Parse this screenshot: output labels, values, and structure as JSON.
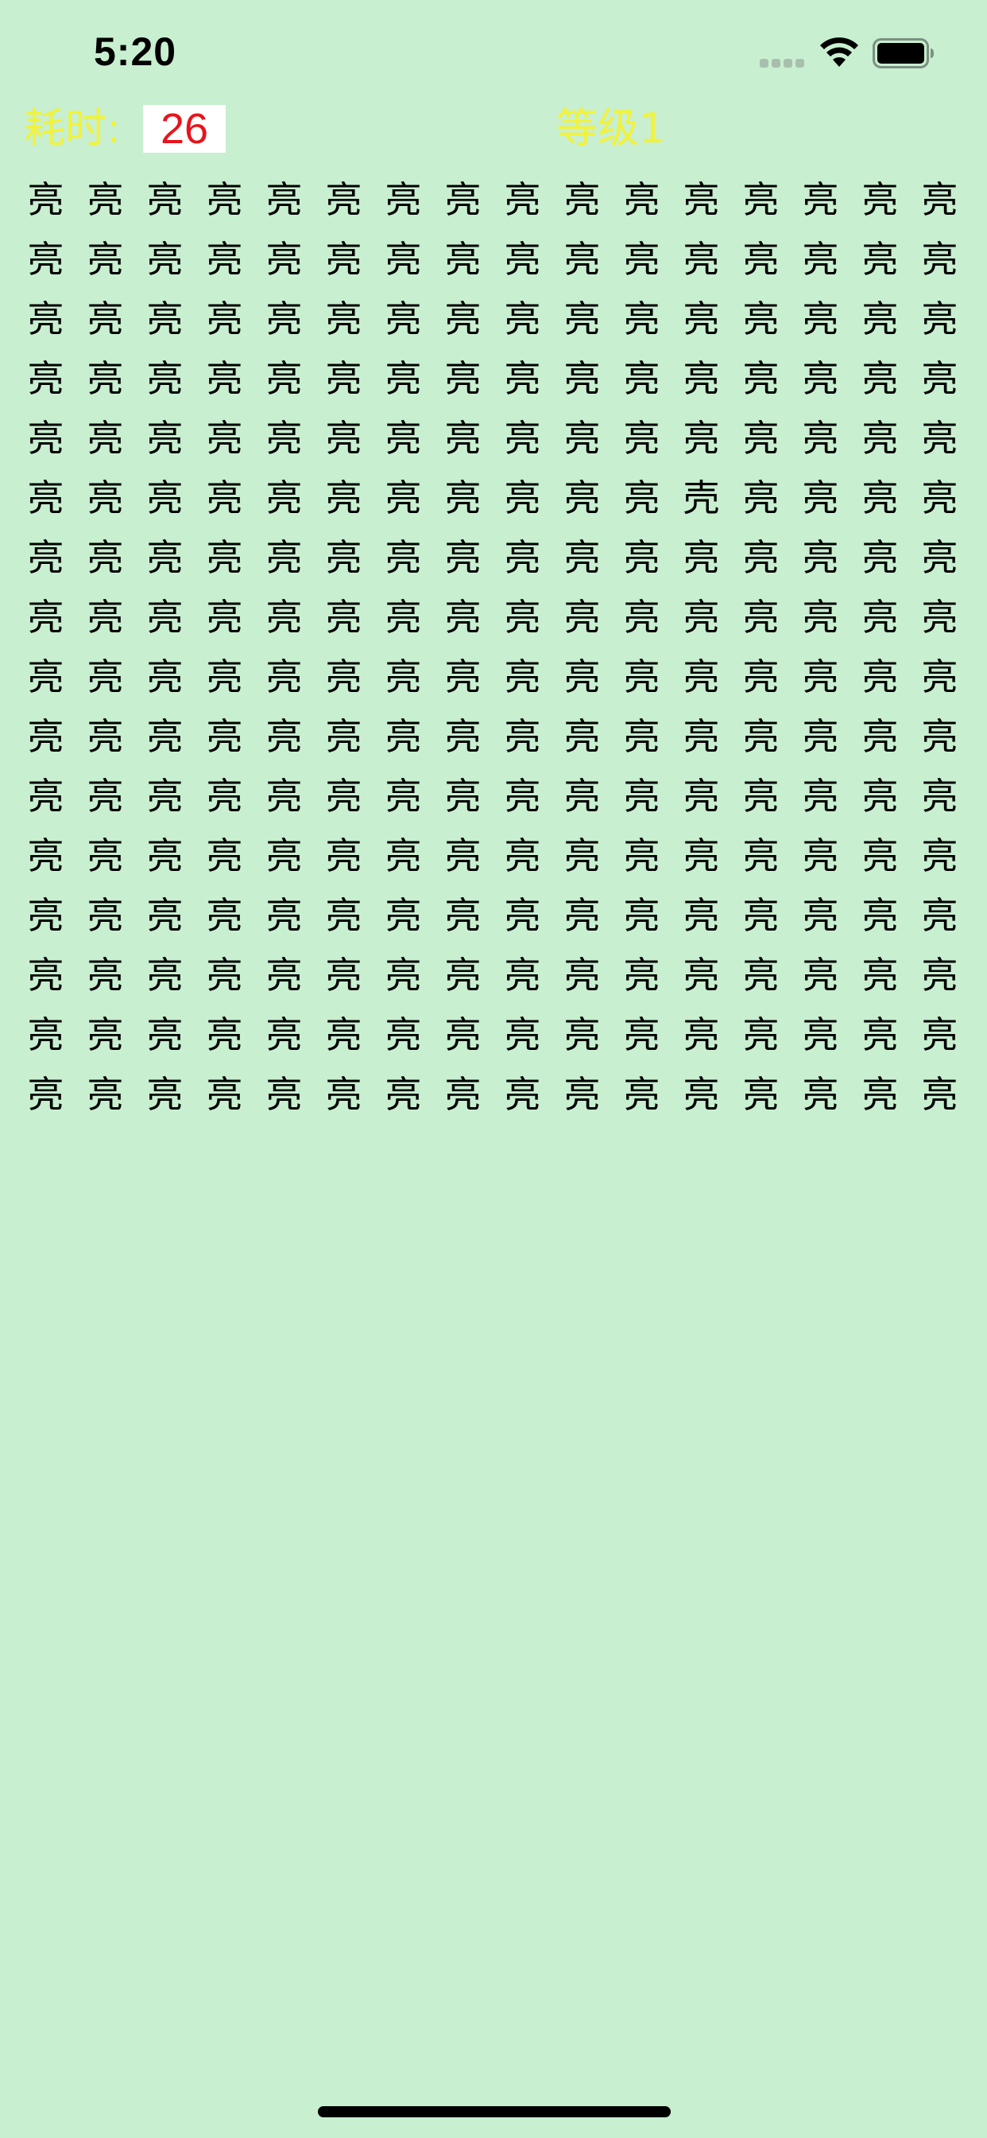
{
  "status_bar": {
    "time": "5:20",
    "icons": [
      "cellular-signal-icon",
      "wifi-icon",
      "battery-icon"
    ]
  },
  "header": {
    "timer_label": "耗时:",
    "timer_value": "26",
    "level_label": "等级1"
  },
  "colors": {
    "background": "#c8efd0",
    "header_text": "#f2f23a",
    "timer_value": "#e8141c",
    "grid_text": "#000000"
  },
  "grid": {
    "rows": 16,
    "columns": 16,
    "base_char": "亮",
    "odd_char": "壳",
    "odd_position": {
      "row": 6,
      "column": 12
    }
  }
}
